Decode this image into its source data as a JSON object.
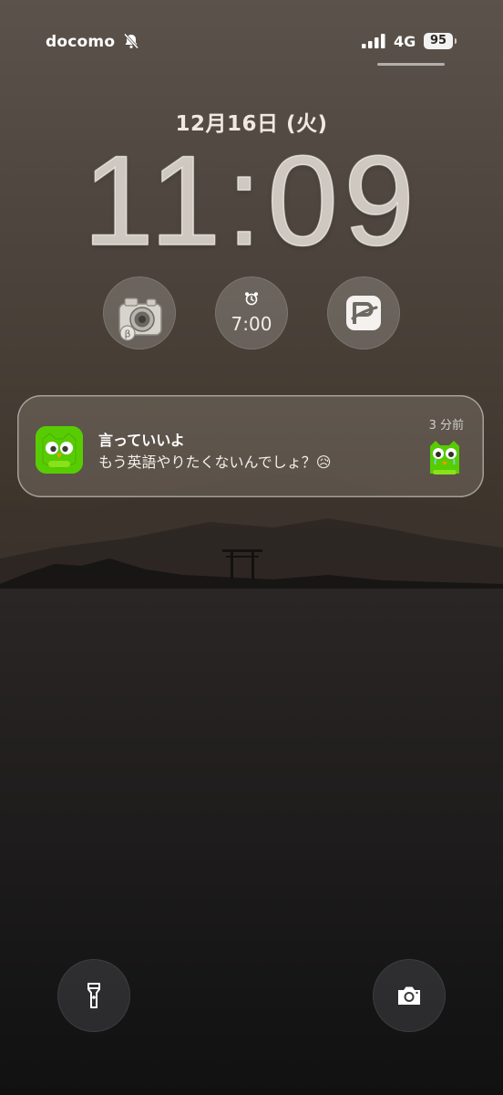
{
  "status_bar": {
    "carrier": "docomo",
    "network": "4G",
    "battery": "95"
  },
  "lock": {
    "date": "12月16日 (火)",
    "time": "11:09"
  },
  "widgets": [
    {
      "icon": "camera-app-icon"
    },
    {
      "icon": "alarm-icon",
      "label": "7:00"
    },
    {
      "icon": "paypay-icon"
    }
  ],
  "notification": {
    "app_icon": "duolingo-owl-icon",
    "title": "言っていいよ",
    "body": "もう英語やりたくないんでしょ？😥",
    "time_ago": "3 分前",
    "accent": "#58cc02"
  },
  "controls": {
    "left": "flashlight-icon",
    "right": "camera-icon"
  }
}
